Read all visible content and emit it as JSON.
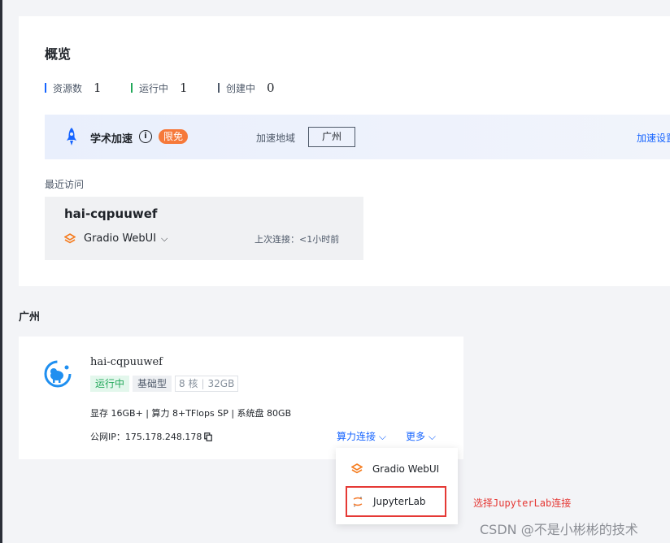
{
  "overview": {
    "title": "概览",
    "stats": [
      {
        "label": "资源数",
        "value": "1",
        "color": "#1664ff"
      },
      {
        "label": "运行中",
        "value": "1",
        "color": "#22a85a"
      },
      {
        "label": "创建中",
        "value": "0",
        "color": "#4e5969"
      }
    ],
    "acceleration": {
      "name": "学术加速",
      "info_icon": "i",
      "badge": "限免",
      "region_label": "加速地域",
      "region_value": "广州",
      "settings_link": "加速设置"
    },
    "recent": {
      "label": "最近访问",
      "instance_name": "hai-cqpuuwef",
      "app_name": "Gradio WebUI",
      "chevron": "⌵",
      "last_connect": "上次连接：<1小时前"
    }
  },
  "region_heading": "广州",
  "instance": {
    "name": "hai-cqpuuwef",
    "status": "运行中",
    "type": "基础型",
    "cores": "8 核",
    "memory": "32GB",
    "specs": "显存 16GB+ | 算力 8+TFlops SP | 系统盘 80GB",
    "ip_label": "公网IP：",
    "ip_value": "175.178.248.178",
    "connect_label": "算力连接 ⌵",
    "more_label": "更多 ⌵"
  },
  "dropdown": {
    "items": [
      {
        "label": "Gradio WebUI",
        "icon": "gradio-icon"
      },
      {
        "label": "JupyterLab",
        "icon": "jupyter-icon"
      }
    ]
  },
  "annotation": "选择JupyterLab连接",
  "watermark": "CSDN @不是小彬彬的技术"
}
